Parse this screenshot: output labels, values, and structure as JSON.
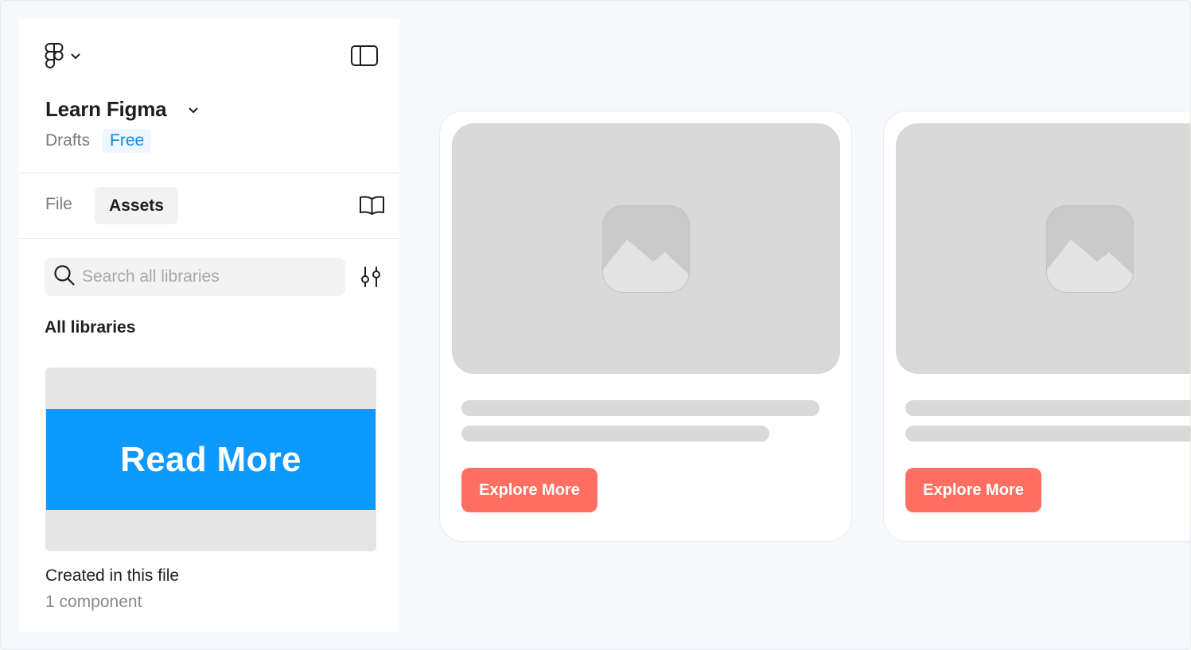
{
  "header": {
    "file_title": "Learn Figma",
    "location": "Drafts",
    "plan_badge": "Free"
  },
  "tabs": [
    {
      "label": "File",
      "active": false
    },
    {
      "label": "Assets",
      "active": true
    }
  ],
  "search": {
    "placeholder": "Search all libraries",
    "value": ""
  },
  "libraries": {
    "heading": "All libraries",
    "items": [
      {
        "preview_label": "Read More",
        "name": "Created in this file",
        "count": "1 component"
      }
    ]
  },
  "canvas": {
    "cards": [
      {
        "button_label": "Explore More"
      },
      {
        "button_label": "Explore More"
      }
    ]
  },
  "icons": {
    "logo": "figma-logo-icon",
    "menu_chevron": "chevron-down-icon",
    "panel_toggle": "sidebar-toggle-icon",
    "library": "book-icon",
    "search": "search-icon",
    "filter": "sliders-icon",
    "image_placeholder": "image-icon"
  },
  "colors": {
    "accent_blue": "#0d99ff",
    "badge_text": "#0d8ce9",
    "button_coral": "#ff6f61",
    "skeleton": "#d9d9d9"
  }
}
